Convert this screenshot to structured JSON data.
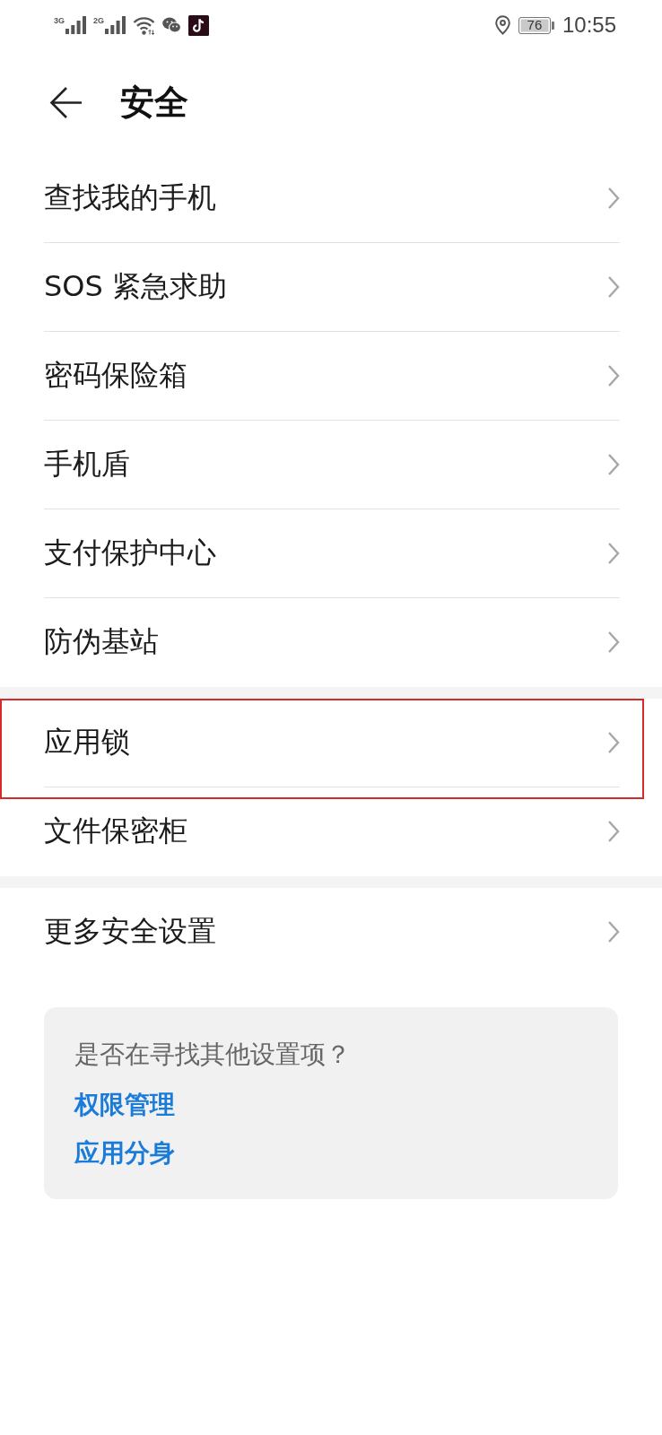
{
  "status_bar": {
    "signals": [
      {
        "label": "3G"
      },
      {
        "label": "2G"
      }
    ],
    "battery": "76",
    "time": "10:55"
  },
  "header": {
    "title": "安全"
  },
  "groups": [
    {
      "items": [
        {
          "label": "查找我的手机",
          "highlighted": false
        },
        {
          "label": "SOS 紧急求助",
          "highlighted": false
        },
        {
          "label": "密码保险箱",
          "highlighted": false
        },
        {
          "label": "手机盾",
          "highlighted": false
        },
        {
          "label": "支付保护中心",
          "highlighted": false
        },
        {
          "label": "防伪基站",
          "highlighted": false
        }
      ]
    },
    {
      "items": [
        {
          "label": "应用锁",
          "highlighted": true
        },
        {
          "label": "文件保密柜",
          "highlighted": false
        }
      ]
    },
    {
      "items": [
        {
          "label": "更多安全设置",
          "highlighted": false
        }
      ]
    }
  ],
  "suggestions": {
    "prompt": "是否在寻找其他设置项？",
    "links": [
      "权限管理",
      "应用分身"
    ]
  }
}
